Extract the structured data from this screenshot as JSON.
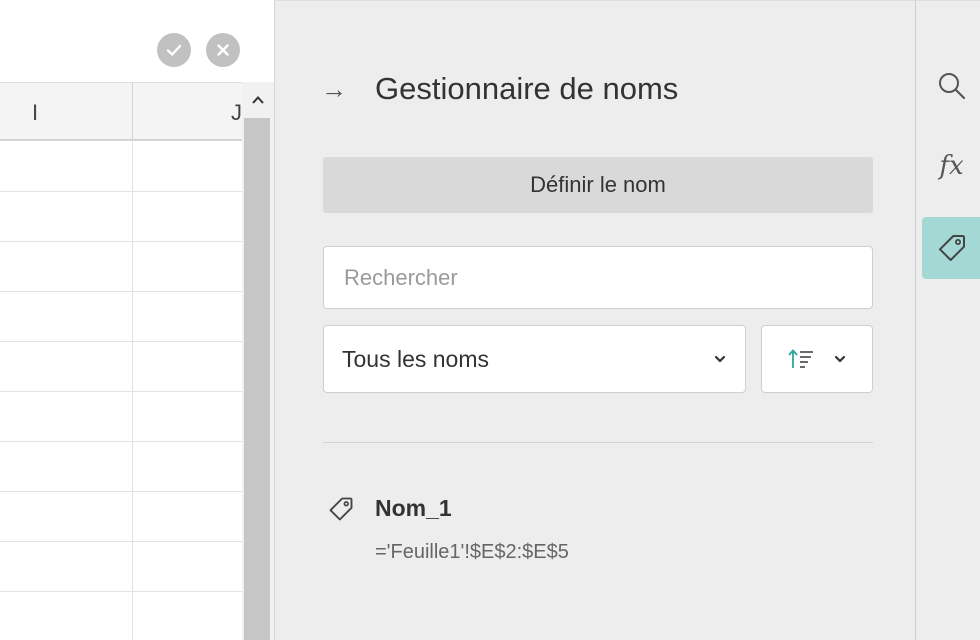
{
  "sheet": {
    "columns": [
      "I",
      "J"
    ],
    "confirm_icon": "check-icon",
    "cancel_icon": "close-icon",
    "row_count": 10
  },
  "panel": {
    "title": "Gestionnaire de noms",
    "back_icon": "arrow-right-icon",
    "define_button": "Définir le nom",
    "search_placeholder": "Rechercher",
    "filter_value": "Tous les noms",
    "sort_icon": "sort-ascending-icon"
  },
  "names": [
    {
      "name": "Nom_1",
      "ref": "='Feuille1'!$E$2:$E$5"
    }
  ],
  "toolbar": {
    "items": [
      "search-icon",
      "function-icon",
      "tag-icon"
    ],
    "fx_label": "fx",
    "active_item": "tag-icon",
    "active_color": "#a3d8d4"
  }
}
